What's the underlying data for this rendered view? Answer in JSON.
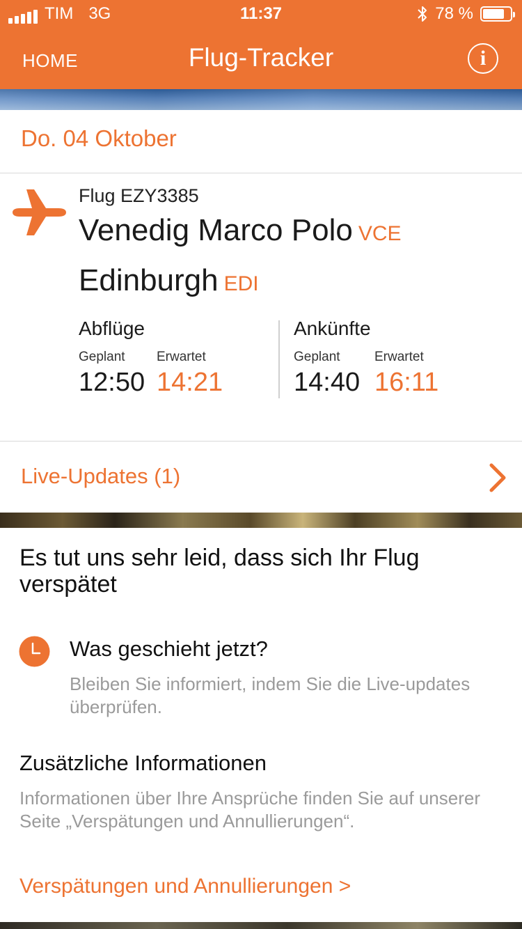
{
  "status_bar": {
    "carrier": "TIM",
    "network": "3G",
    "time": "11:37",
    "battery_text": "78 %",
    "battery_level": 0.78,
    "signal_bars": 5
  },
  "nav": {
    "home_label": "HOME",
    "title": "Flug-Tracker",
    "info_label": "i"
  },
  "flight": {
    "date": "Do. 04 Oktober",
    "flight_number": "Flug EZY3385",
    "origin": {
      "name": "Venedig Marco Polo",
      "code": "VCE"
    },
    "destination": {
      "name": "Edinburgh",
      "code": "EDI"
    },
    "departures": {
      "heading": "Abflüge",
      "planned_label": "Geplant",
      "expected_label": "Erwartet",
      "planned": "12:50",
      "expected": "14:21"
    },
    "arrivals": {
      "heading": "Ankünfte",
      "planned_label": "Geplant",
      "expected_label": "Erwartet",
      "planned": "14:40",
      "expected": "16:11"
    }
  },
  "live_updates": {
    "label": "Live-Updates (1)"
  },
  "info": {
    "headline": "Es tut uns sehr leid, dass sich Ihr Flug verspätet",
    "what_next_title": "Was geschieht jetzt?",
    "what_next_body": "Bleiben Sie informiert, indem Sie die Live-updates überprüfen.",
    "additional_title": "Zusätzliche Informationen",
    "additional_body": "Informationen über Ihre Ansprüche finden Sie auf unserer Seite „Verspätungen und Annullierungen“.",
    "link_label": "Verspätungen und Annullierungen >"
  },
  "colors": {
    "brand_orange": "#ed7332",
    "text_dark": "#1a1a1a",
    "text_muted": "#9a9a9a"
  },
  "icons": {
    "plane": "airplane-icon",
    "clock": "clock-icon",
    "info": "info-icon",
    "chevron": "chevron-right-icon",
    "bluetooth": "bluetooth-icon",
    "battery": "battery-icon",
    "signal": "signal-icon"
  }
}
